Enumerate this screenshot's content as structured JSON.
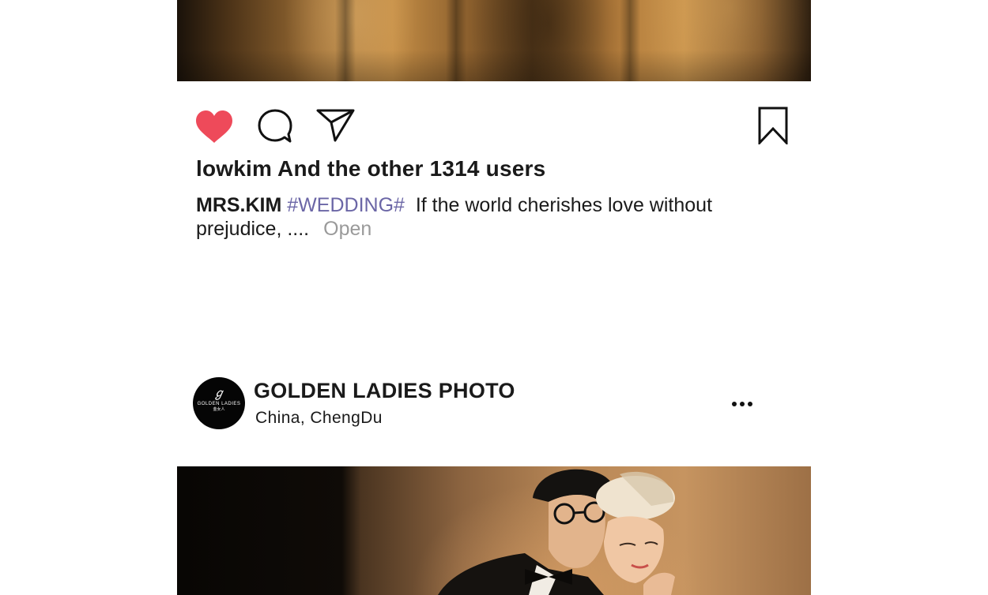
{
  "post_top": {
    "likes_text": "lowkim And the other 1314 users",
    "caption": {
      "username": "MRS.KIM",
      "hashtag": "#WEDDING#",
      "text": "If the world cherishes love without prejudice, ....",
      "more_label": "Open"
    },
    "actions": {
      "like_icon": "heart-icon",
      "comment_icon": "comment-icon",
      "share_icon": "send-icon",
      "save_icon": "bookmark-icon",
      "liked_color": "#ee4a5a"
    }
  },
  "post_next": {
    "account_name": "GOLDEN LADIES PHOTO",
    "location": "China,  ChengDu",
    "avatar_text": {
      "brand": "GOLDEN LADIES",
      "sub": "金女人"
    },
    "more_icon": "more-dots-icon"
  },
  "colors": {
    "hashtag": "#6b66a6",
    "muted": "#9a9a9a",
    "text": "#1a1a1a"
  }
}
